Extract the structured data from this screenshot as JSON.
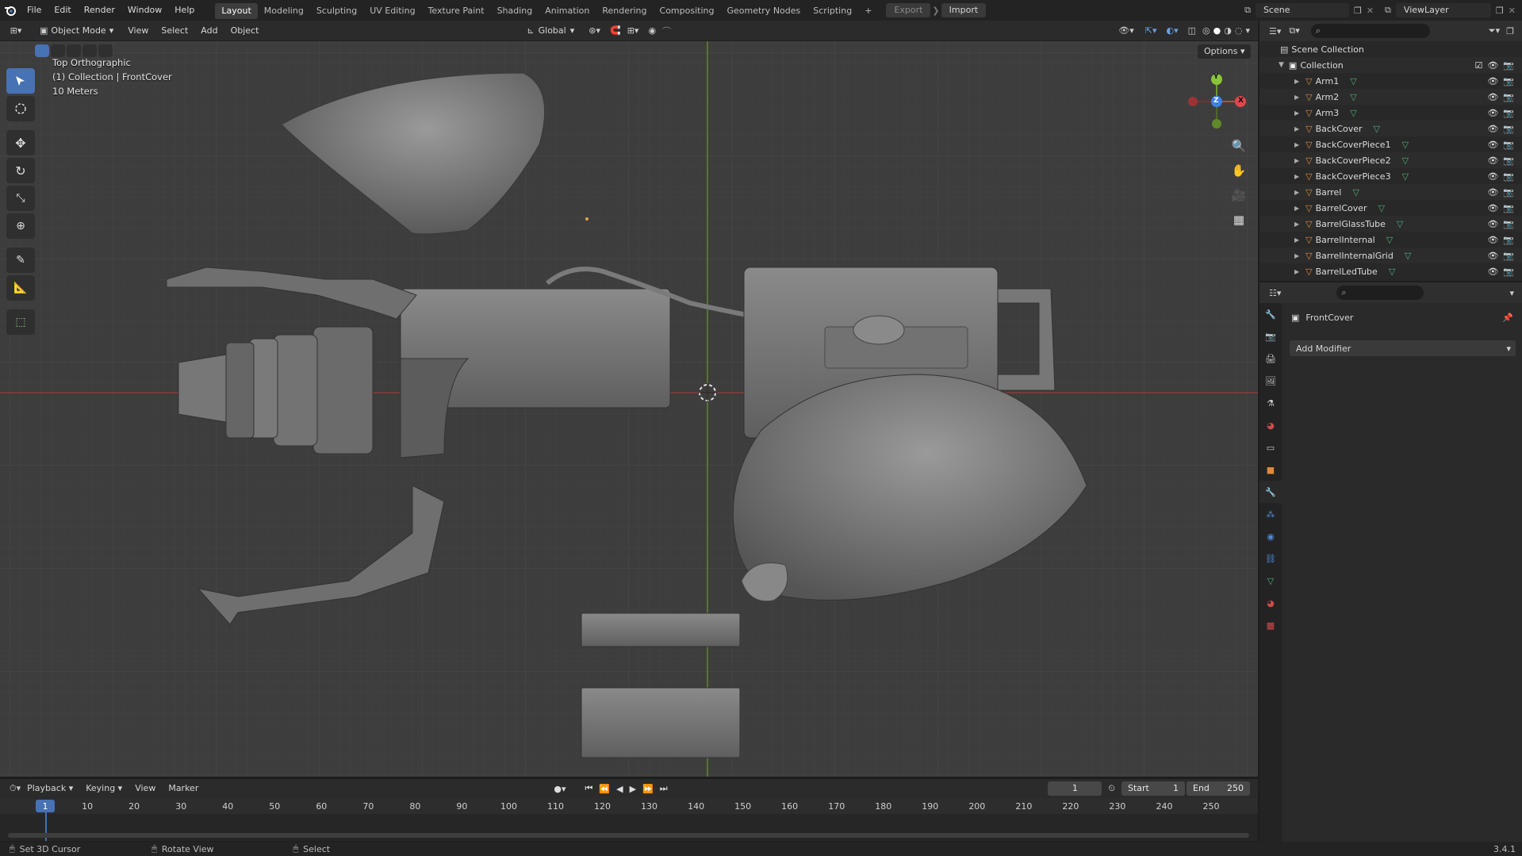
{
  "topbar": {
    "menus": [
      "File",
      "Edit",
      "Render",
      "Window",
      "Help"
    ],
    "workspaces": [
      "Layout",
      "Modeling",
      "Sculpting",
      "UV Editing",
      "Texture Paint",
      "Shading",
      "Animation",
      "Rendering",
      "Compositing",
      "Geometry Nodes",
      "Scripting"
    ],
    "active_workspace": "Layout",
    "add_tab": "+",
    "export_label": "Export",
    "import_label": "Import",
    "scene_label": "Scene",
    "viewlayer_label": "ViewLayer"
  },
  "header3d": {
    "mode": "Object Mode",
    "menus": [
      "View",
      "Select",
      "Add",
      "Object"
    ],
    "orientation": "Global",
    "options": "Options"
  },
  "viewport": {
    "view_name": "Top Orthographic",
    "collection_info": "(1) Collection | FrontCover",
    "scale": "10 Meters",
    "gizmo_y": "Y",
    "gizmo_z": "Z",
    "gizmo_x": "X"
  },
  "outliner": {
    "root": "Scene Collection",
    "collection": "Collection",
    "items": [
      "Arm1",
      "Arm2",
      "Arm3",
      "BackCover",
      "BackCoverPiece1",
      "BackCoverPiece2",
      "BackCoverPiece3",
      "Barrel",
      "BarrelCover",
      "BarrelGlassTube",
      "BarrelInternal",
      "BarrelInternalGrid",
      "BarrelLedTube"
    ]
  },
  "properties": {
    "object_name": "FrontCover",
    "add_modifier": "Add Modifier"
  },
  "timeline": {
    "menus": [
      "Playback",
      "Keying",
      "View",
      "Marker"
    ],
    "current_frame": "1",
    "start_label": "Start",
    "start_value": "1",
    "end_label": "End",
    "end_value": "250",
    "ruler": [
      "1",
      "10",
      "20",
      "30",
      "40",
      "50",
      "60",
      "70",
      "80",
      "90",
      "100",
      "110",
      "120",
      "130",
      "140",
      "150",
      "160",
      "170",
      "180",
      "190",
      "200",
      "210",
      "220",
      "230",
      "240",
      "250"
    ]
  },
  "statusbar": {
    "hint1": "Set 3D Cursor",
    "hint2": "Rotate View",
    "hint3": "Select",
    "version": "3.4.1"
  },
  "colors": {
    "accent": "#4772b3",
    "axis_x": "#9b3a3a",
    "axis_y": "#6a9a2a",
    "mesh_icon": "#e08a3c",
    "data_icon": "#4fb07a"
  }
}
